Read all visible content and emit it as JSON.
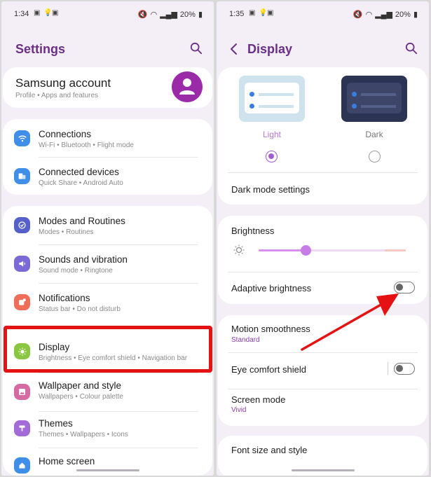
{
  "left_screen": {
    "status": {
      "time": "1:34",
      "battery": "20%"
    },
    "appbar": {
      "title": "Settings"
    },
    "account": {
      "title": "Samsung account",
      "subtitle": "Profile  •  Apps and features"
    },
    "items": [
      {
        "label": "Connections",
        "sub": "Wi-Fi  •  Bluetooth  •  Flight mode"
      },
      {
        "label": "Connected devices",
        "sub": "Quick Share  •  Android Auto"
      },
      {
        "label": "Modes and Routines",
        "sub": "Modes  •  Routines"
      },
      {
        "label": "Sounds and vibration",
        "sub": "Sound mode  •  Ringtone"
      },
      {
        "label": "Notifications",
        "sub": "Status bar  •  Do not disturb"
      },
      {
        "label": "Display",
        "sub": "Brightness  •  Eye comfort shield  •  Navigation bar"
      },
      {
        "label": "Wallpaper and style",
        "sub": "Wallpapers  •  Colour palette"
      },
      {
        "label": "Themes",
        "sub": "Themes  •  Wallpapers  •  Icons"
      },
      {
        "label": "Home screen",
        "sub": ""
      }
    ]
  },
  "right_screen": {
    "status": {
      "time": "1:35",
      "battery": "20%"
    },
    "appbar": {
      "title": "Display"
    },
    "theme": {
      "light_label": "Light",
      "dark_label": "Dark",
      "selected": "Light"
    },
    "dark_mode_settings": "Dark mode settings",
    "brightness": {
      "label": "Brightness",
      "level": 0.32
    },
    "adaptive_brightness": {
      "label": "Adaptive brightness",
      "on": false
    },
    "motion_smoothness": {
      "label": "Motion smoothness",
      "value": "Standard"
    },
    "eye_comfort": {
      "label": "Eye comfort shield",
      "on": false
    },
    "screen_mode": {
      "label": "Screen mode",
      "value": "Vivid"
    },
    "font_size": {
      "label": "Font size and style"
    }
  },
  "colors": {
    "accent_purple": "#6a2f86",
    "highlight_red": "#e41212",
    "arrow_red": "#e41212",
    "connections_icon": "#3f8ee8",
    "connected_devices_icon": "#3f8ee8",
    "modes_icon": "#5561c9",
    "sounds_icon": "#7b6ad6",
    "notifications_icon": "#ee6e5a",
    "display_icon": "#8ac740",
    "wallpaper_icon": "#d66ba4",
    "themes_icon": "#a36bd6",
    "home_icon": "#3f8ee8"
  }
}
